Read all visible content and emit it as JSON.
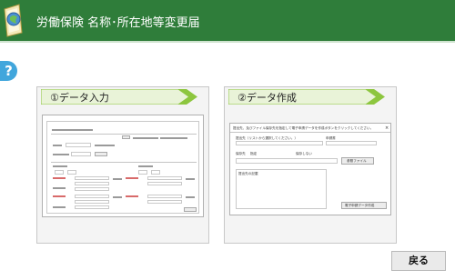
{
  "header": {
    "title": "労働保険 名称･所在地等変更届"
  },
  "help": {
    "label": "?"
  },
  "steps": [
    {
      "label": "①データ入力"
    },
    {
      "label": "②データ作成"
    }
  ],
  "dialog": {
    "instruction": "提出先、及びファイル保存先を指定して電子申請データを作成ボタンをクリックしてください。",
    "submit_label": "提出先（リストから選択してください。）",
    "doc_label": "申請書",
    "save_label": "保存先",
    "opt_specify": "指定",
    "opt_none": "保存しない",
    "ref_button": "参照ファイル",
    "notes_label": "提出先の記載",
    "create_button": "電子申請データ作成",
    "close": "×"
  },
  "footer": {
    "back_label": "戻る"
  },
  "colors": {
    "header": "#2f7d3a",
    "help": "#41a6dc",
    "step_arrow": "#8dc63f"
  }
}
